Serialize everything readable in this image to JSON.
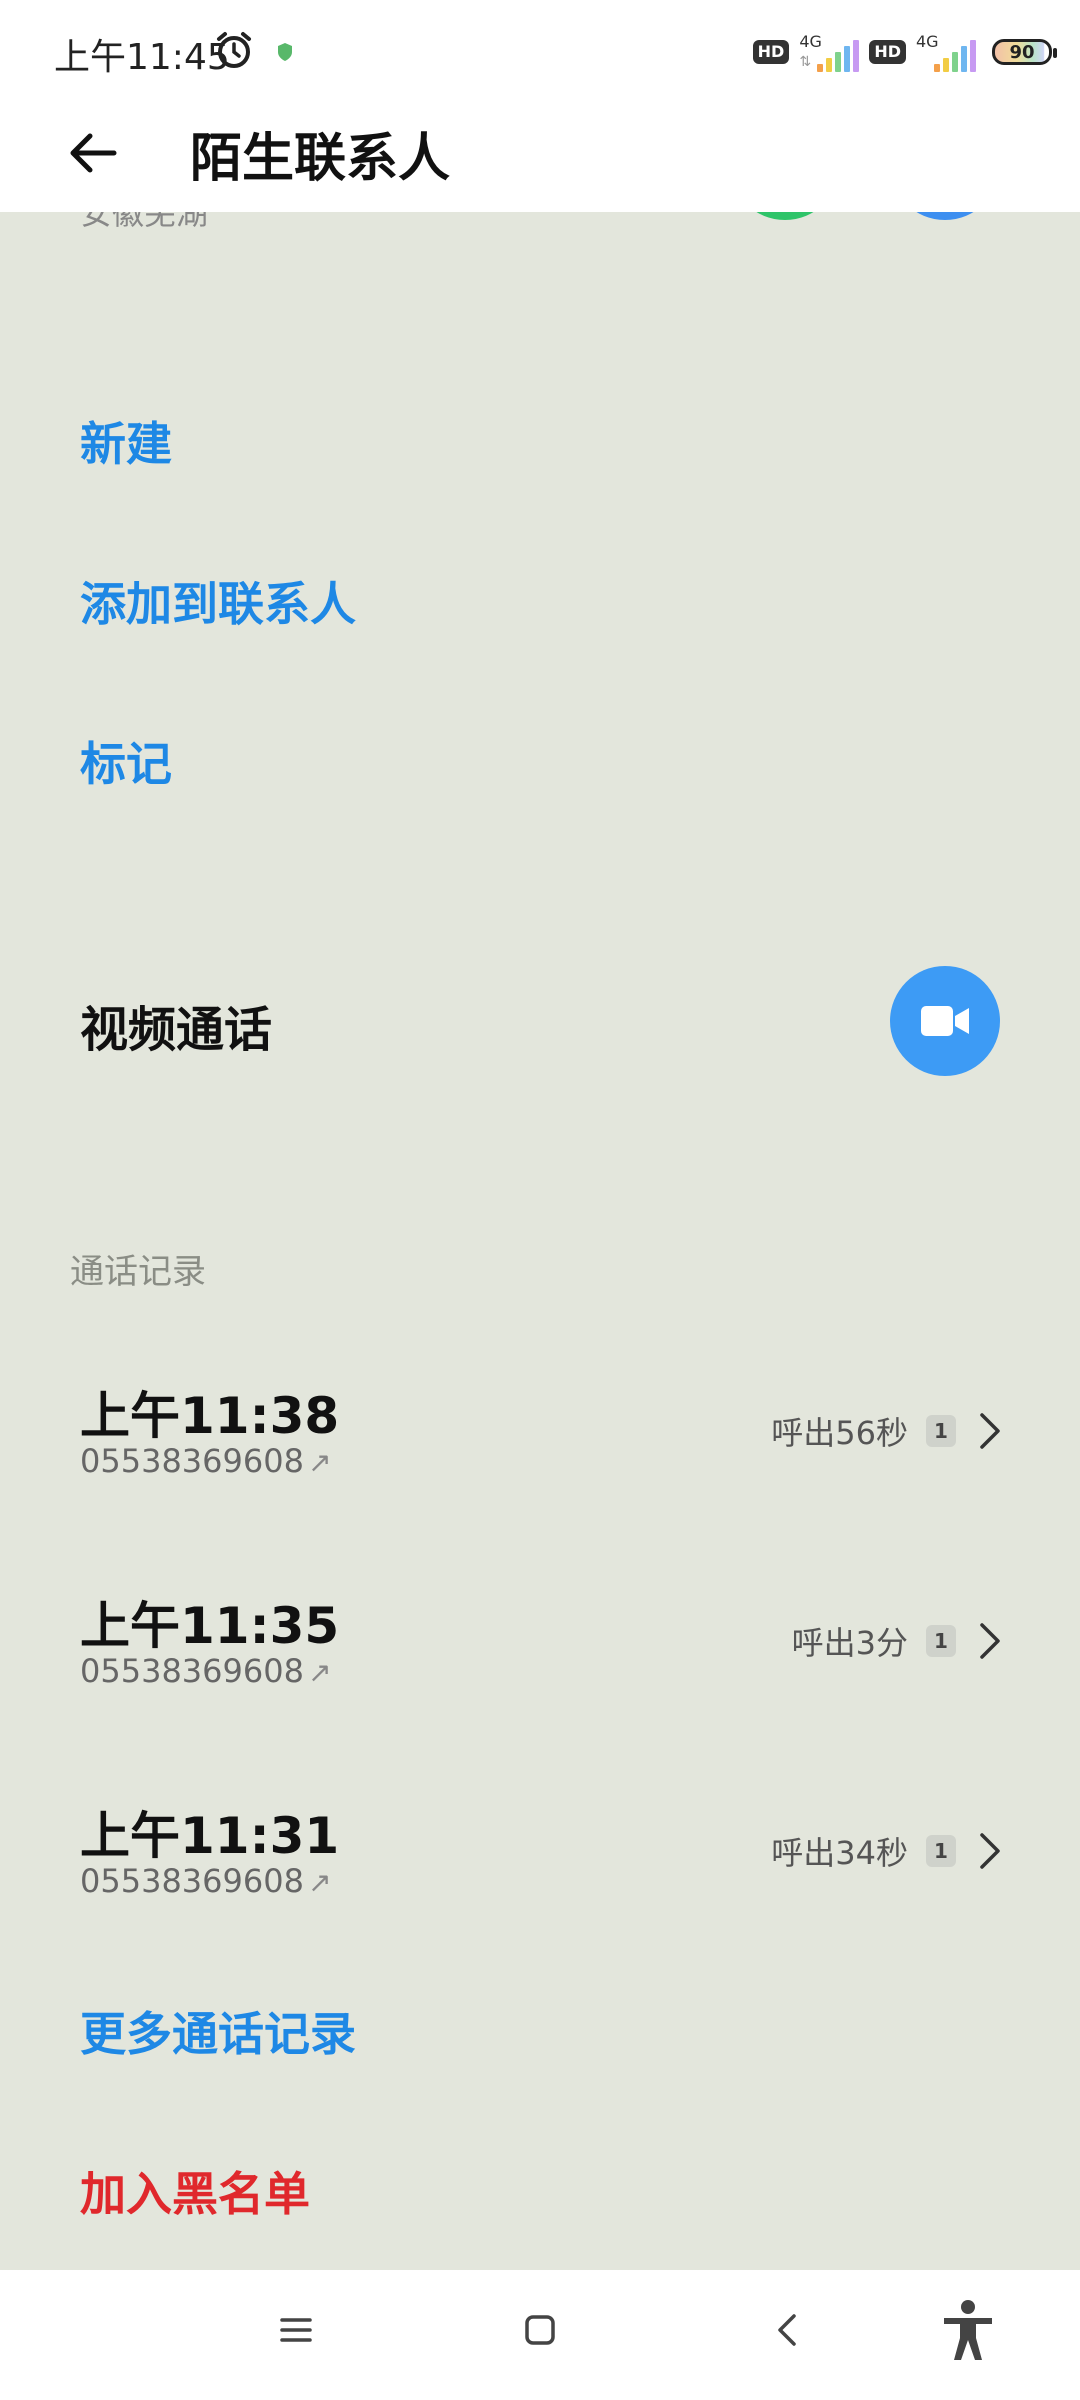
{
  "status_bar": {
    "time": "上午11:45",
    "hd_label": "HD",
    "network": "4G",
    "battery": "90"
  },
  "app_bar": {
    "title": "陌生联系人"
  },
  "peek": {
    "text": "安徽芜湖"
  },
  "actions": {
    "new": "新建",
    "add_to_contacts": "添加到联系人",
    "mark": "标记"
  },
  "video_call": {
    "label": "视频通话"
  },
  "call_log": {
    "header": "通话记录",
    "items": [
      {
        "time": "上午11:38",
        "number": "05538369608",
        "direction_icon": "↗",
        "duration": "呼出56秒",
        "sim": "1"
      },
      {
        "time": "上午11:35",
        "number": "05538369608",
        "direction_icon": "↗",
        "duration": "呼出3分",
        "sim": "1"
      },
      {
        "time": "上午11:31",
        "number": "05538369608",
        "direction_icon": "↗",
        "duration": "呼出34秒",
        "sim": "1"
      }
    ],
    "more": "更多通话记录"
  },
  "blacklist": {
    "label": "加入黑名单"
  },
  "colors": {
    "accent": "#1e88e5",
    "danger": "#e0282c",
    "background": "#e3e6dc"
  }
}
